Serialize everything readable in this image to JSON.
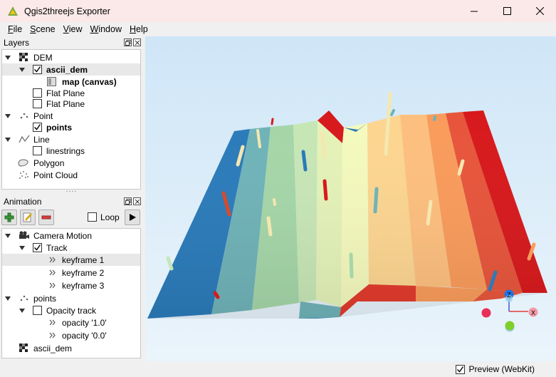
{
  "window": {
    "title": "Qgis2threejs Exporter",
    "minimize_icon": "minimize-icon",
    "maximize_icon": "maximize-icon",
    "close_icon": "close-icon"
  },
  "menu": [
    {
      "accel": "F",
      "rest": "ile"
    },
    {
      "accel": "S",
      "rest": "cene"
    },
    {
      "accel": "V",
      "rest": "iew"
    },
    {
      "accel": "W",
      "rest": "indow"
    },
    {
      "accel": "H",
      "rest": "elp"
    }
  ],
  "layers_panel": {
    "title": "Layers",
    "items": [
      {
        "label": "DEM",
        "expanded": true,
        "icon": "raster-icon"
      },
      {
        "label": "ascii_dem",
        "checked": true,
        "bold": true,
        "expanded": true
      },
      {
        "label": "map (canvas)",
        "bold": true,
        "icon": "map-canvas-icon"
      },
      {
        "label": "Flat Plane",
        "checked": false
      },
      {
        "label": "Flat Plane",
        "checked": false
      },
      {
        "label": "Point",
        "expanded": true,
        "icon": "point-icon"
      },
      {
        "label": "points",
        "checked": true,
        "bold": true
      },
      {
        "label": "Line",
        "expanded": true,
        "icon": "line-icon"
      },
      {
        "label": "linestrings",
        "checked": false
      },
      {
        "label": "Polygon",
        "icon": "polygon-icon"
      },
      {
        "label": "Point Cloud",
        "icon": "point-cloud-icon"
      }
    ]
  },
  "animation_panel": {
    "title": "Animation",
    "toolbar": {
      "add_icon": "add-icon",
      "edit_icon": "edit-icon",
      "remove_icon": "remove-icon",
      "loop_label": "Loop",
      "loop_checked": false,
      "play_icon": "play-icon"
    },
    "items": [
      {
        "label": "Camera Motion",
        "icon": "camera-icon",
        "expanded": true
      },
      {
        "label": "Track",
        "checked": true,
        "expanded": true
      },
      {
        "label": "keyframe 1",
        "selected": true
      },
      {
        "label": "keyframe 2"
      },
      {
        "label": "keyframe 3"
      },
      {
        "label": "points",
        "icon": "point-icon",
        "expanded": true
      },
      {
        "label": "Opacity track",
        "checked": false,
        "expanded": true
      },
      {
        "label": "opacity '1.0'"
      },
      {
        "label": "opacity '0.0'"
      },
      {
        "label": "ascii_dem",
        "icon": "raster-icon"
      }
    ]
  },
  "viewer": {
    "axes": {
      "z": "Z",
      "x": "X"
    },
    "colors": {
      "blue": "#2b7bba",
      "teal": "#6fb3b8",
      "light_green": "#c7e6b6",
      "pale_yellow": "#f4f9bd",
      "light_orange": "#fcd590",
      "orange": "#f99b5b",
      "red_orange": "#e7553b",
      "red": "#d7191c"
    }
  },
  "statusbar": {
    "preview_label": "Preview (WebKit)",
    "preview_checked": true
  }
}
